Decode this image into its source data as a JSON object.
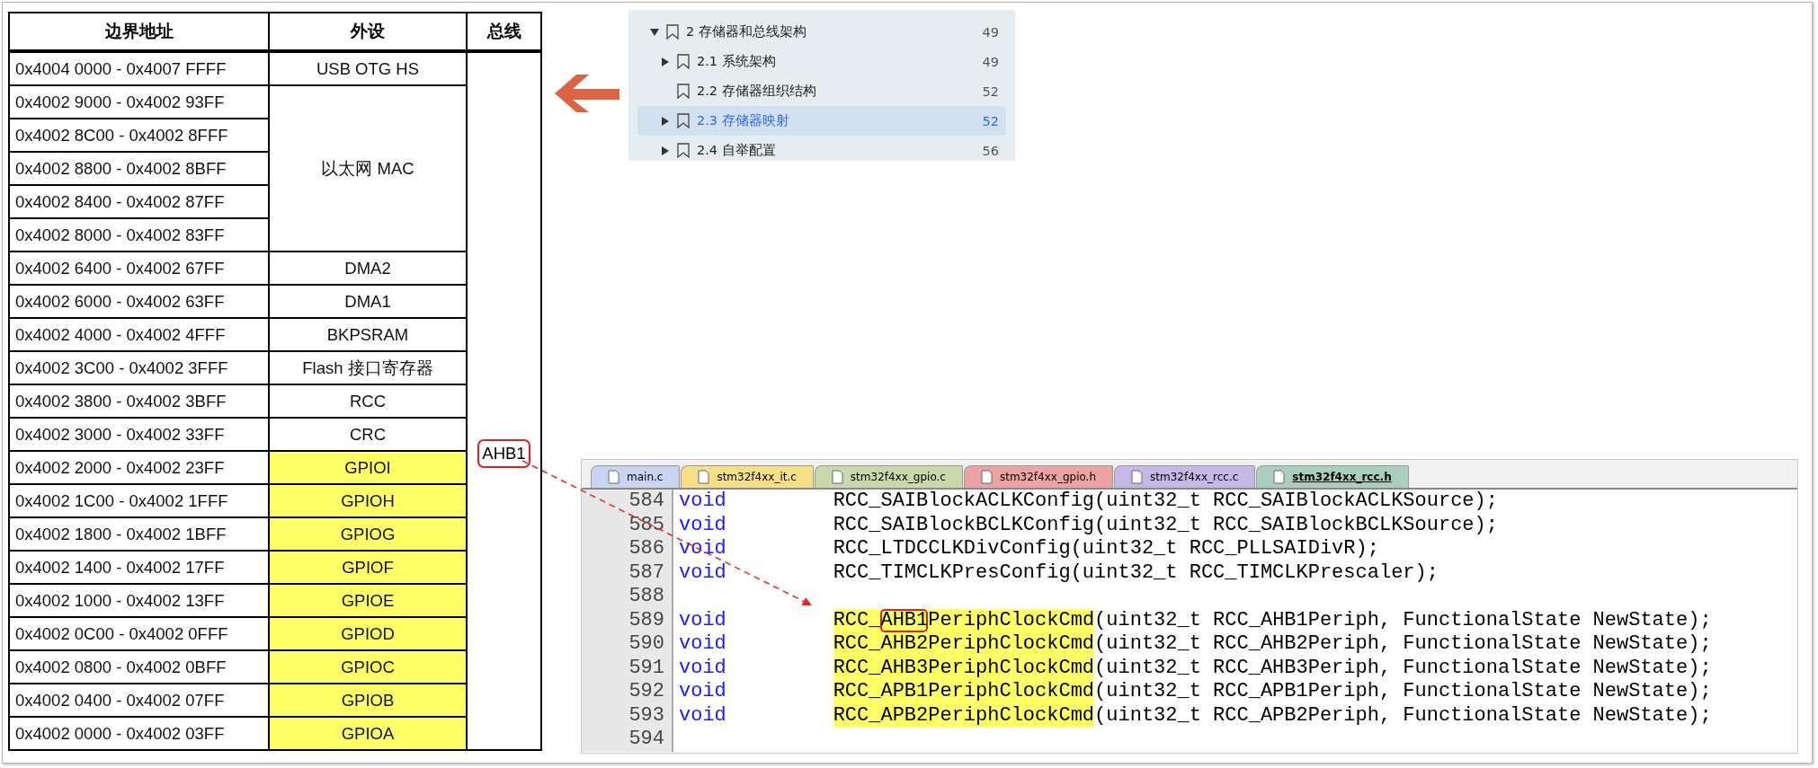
{
  "table": {
    "columns": [
      "边界地址",
      "外设",
      "总线"
    ],
    "groups": [
      {
        "peripheral": "USB OTG HS",
        "highlighted": false,
        "addresses": [
          "0x4004 0000 - 0x4007 FFFF"
        ]
      },
      {
        "peripheral": "以太网 MAC",
        "highlighted": false,
        "addresses": [
          "0x4002 9000 - 0x4002 93FF",
          "0x4002 8C00 - 0x4002 8FFF",
          "0x4002 8800 - 0x4002 8BFF",
          "0x4002 8400 - 0x4002 87FF",
          "0x4002 8000 - 0x4002 83FF"
        ]
      },
      {
        "peripheral": "DMA2",
        "highlighted": false,
        "addresses": [
          "0x4002 6400 - 0x4002 67FF"
        ]
      },
      {
        "peripheral": "DMA1",
        "highlighted": false,
        "addresses": [
          "0x4002 6000 - 0x4002 63FF"
        ]
      },
      {
        "peripheral": "BKPSRAM",
        "highlighted": false,
        "addresses": [
          "0x4002 4000 - 0x4002 4FFF"
        ]
      },
      {
        "peripheral": "Flash 接口寄存器",
        "highlighted": false,
        "addresses": [
          "0x4002 3C00 - 0x4002 3FFF"
        ]
      },
      {
        "peripheral": "RCC",
        "highlighted": false,
        "addresses": [
          "0x4002 3800 - 0x4002 3BFF"
        ]
      },
      {
        "peripheral": "CRC",
        "highlighted": false,
        "addresses": [
          "0x4002 3000 - 0x4002 33FF"
        ]
      },
      {
        "peripheral": "GPIOI",
        "highlighted": true,
        "addresses": [
          "0x4002 2000 - 0x4002 23FF"
        ]
      },
      {
        "peripheral": "GPIOH",
        "highlighted": true,
        "addresses": [
          "0x4002 1C00 - 0x4002 1FFF"
        ]
      },
      {
        "peripheral": "GPIOG",
        "highlighted": true,
        "addresses": [
          "0x4002 1800 - 0x4002 1BFF"
        ]
      },
      {
        "peripheral": "GPIOF",
        "highlighted": true,
        "addresses": [
          "0x4002 1400 - 0x4002 17FF"
        ]
      },
      {
        "peripheral": "GPIOE",
        "highlighted": true,
        "addresses": [
          "0x4002 1000 - 0x4002 13FF"
        ]
      },
      {
        "peripheral": "GPIOD",
        "highlighted": true,
        "addresses": [
          "0x4002 0C00 - 0x4002 0FFF"
        ]
      },
      {
        "peripheral": "GPIOC",
        "highlighted": true,
        "addresses": [
          "0x4002 0800 - 0x4002 0BFF"
        ]
      },
      {
        "peripheral": "GPIOB",
        "highlighted": true,
        "addresses": [
          "0x4002 0400 - 0x4002 07FF"
        ]
      },
      {
        "peripheral": "GPIOA",
        "highlighted": true,
        "addresses": [
          "0x4002 0000 - 0x4002 03FF"
        ]
      }
    ],
    "bus": "AHB1"
  },
  "bookmarks": [
    {
      "title": "2 存储器和总线架构",
      "page": "49",
      "selected": false,
      "expandable": true,
      "expanded": true,
      "children": [
        {
          "title": "2.1 系统架构",
          "page": "49",
          "selected": false,
          "expandable": true,
          "expanded": false
        },
        {
          "title": "2.2 存储器组织结构",
          "page": "52",
          "selected": false,
          "expandable": false
        },
        {
          "title": "2.3 存储器映射",
          "page": "52",
          "selected": true,
          "expandable": true,
          "expanded": false
        },
        {
          "title": "2.4 自举配置",
          "page": "56",
          "selected": false,
          "expandable": true,
          "expanded": false
        }
      ]
    }
  ],
  "editor": {
    "tabs": [
      {
        "label": "main.c",
        "color": "#c9d5f0",
        "selected": false
      },
      {
        "label": "stm32f4xx_it.c",
        "color": "#f7df86",
        "selected": false
      },
      {
        "label": "stm32f4xx_gpio.c",
        "color": "#c9d9a9",
        "selected": false
      },
      {
        "label": "stm32f4xx_gpio.h",
        "color": "#eea3a3",
        "selected": false
      },
      {
        "label": "stm32f4xx_rcc.c",
        "color": "#c6b8e6",
        "selected": false
      },
      {
        "label": "stm32f4xx_rcc.h",
        "color": "#a9cfbf",
        "selected": true
      }
    ],
    "lines": [
      {
        "number": "584",
        "keyword": "void",
        "func": [
          {
            "text": "RCC_SAIBlockACLKConfig",
            "boxed": false
          }
        ],
        "params": "(uint32_t RCC_SAIBlockACLKSource);",
        "highlighted": false
      },
      {
        "number": "585",
        "keyword": "void",
        "func": [
          {
            "text": "RCC_SAIBlockBCLKConfig",
            "boxed": false
          }
        ],
        "params": "(uint32_t RCC_SAIBlockBCLKSource);",
        "highlighted": false
      },
      {
        "number": "586",
        "keyword": "void",
        "func": [
          {
            "text": "RCC_LTDCCLKDivConfig",
            "boxed": false
          }
        ],
        "params": "(uint32_t RCC_PLLSAIDivR);",
        "highlighted": false
      },
      {
        "number": "587",
        "keyword": "void",
        "func": [
          {
            "text": "RCC_TIMCLKPresConfig",
            "boxed": false
          }
        ],
        "params": "(uint32_t RCC_TIMCLKPrescaler);",
        "highlighted": false
      },
      {
        "number": "588"
      },
      {
        "number": "589",
        "keyword": "void",
        "func": [
          {
            "text": "RCC_",
            "boxed": false
          },
          {
            "text": "AHB1",
            "boxed": true
          },
          {
            "text": "PeriphClockCmd",
            "boxed": false
          }
        ],
        "params": "(uint32_t RCC_AHB1Periph, FunctionalState NewState);",
        "highlighted": true
      },
      {
        "number": "590",
        "keyword": "void",
        "func": [
          {
            "text": "RCC_AHB2PeriphClockCmd",
            "boxed": false
          }
        ],
        "params": "(uint32_t RCC_AHB2Periph, FunctionalState NewState);",
        "highlighted": true
      },
      {
        "number": "591",
        "keyword": "void",
        "func": [
          {
            "text": "RCC_AHB3PeriphClockCmd",
            "boxed": false
          }
        ],
        "params": "(uint32_t RCC_AHB3Periph, FunctionalState NewState);",
        "highlighted": true
      },
      {
        "number": "592",
        "keyword": "void",
        "func": [
          {
            "text": "RCC_APB1PeriphClockCmd",
            "boxed": false
          }
        ],
        "params": "(uint32_t RCC_APB1Periph, FunctionalState NewState);",
        "highlighted": true
      },
      {
        "number": "593",
        "keyword": "void",
        "func": [
          {
            "text": "RCC_APB2PeriphClockCmd",
            "boxed": false
          }
        ],
        "params": "(uint32_t RCC_APB2Periph, FunctionalState NewState);",
        "highlighted": true
      },
      {
        "number": "594"
      }
    ]
  }
}
